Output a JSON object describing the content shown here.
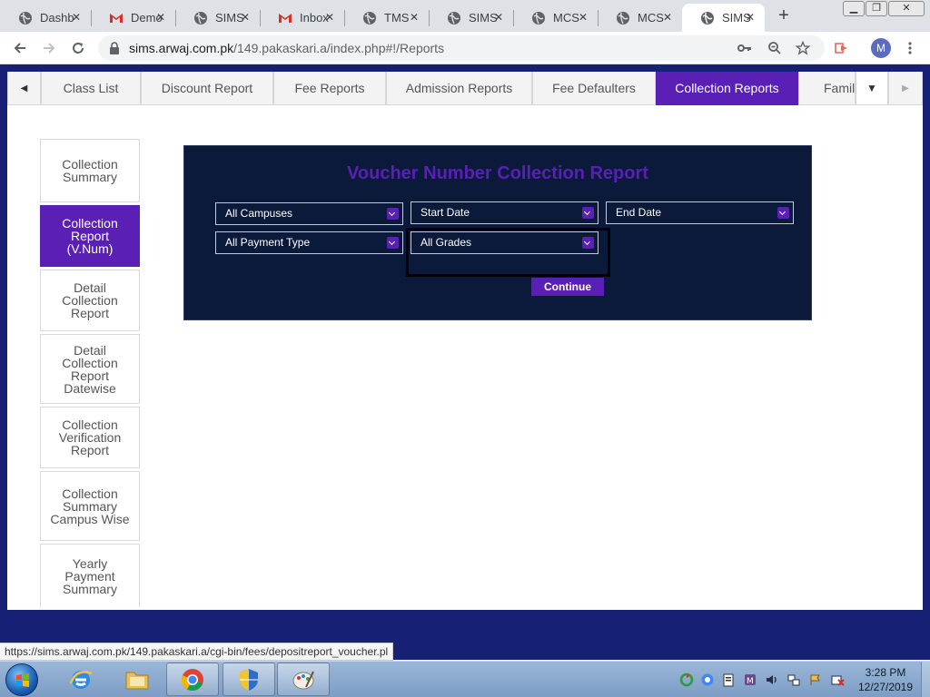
{
  "browser": {
    "tabs": [
      {
        "title": "Dashb",
        "icon": "globe-icon"
      },
      {
        "title": "Demo",
        "icon": "gmail-icon"
      },
      {
        "title": "SIMS",
        "icon": "globe-icon"
      },
      {
        "title": "Inbox",
        "icon": "gmail-icon"
      },
      {
        "title": "TMS",
        "icon": "globe-icon"
      },
      {
        "title": "SIMS",
        "icon": "globe-icon"
      },
      {
        "title": "MCS",
        "icon": "globe-icon"
      },
      {
        "title": "MCS",
        "icon": "globe-icon"
      },
      {
        "title": "SIMS",
        "icon": "globe-icon",
        "active": true
      }
    ],
    "url_host": "sims.arwaj.com.pk",
    "url_path": "/149.pakaskari.a/index.php#!/Reports",
    "profile_initial": "M"
  },
  "report_tabs": [
    {
      "label": "Class List"
    },
    {
      "label": "Discount Report"
    },
    {
      "label": "Fee Reports"
    },
    {
      "label": "Admission Reports"
    },
    {
      "label": "Fee Defaulters"
    },
    {
      "label": "Collection Reports",
      "active": true
    },
    {
      "label": "Family"
    }
  ],
  "sidebar": {
    "items": [
      {
        "label": "Collection Summary"
      },
      {
        "label": "Collection Report (V.Num)",
        "active": true
      },
      {
        "label": "Detail Collection Report"
      },
      {
        "label": "Detail Collection Report Datewise"
      },
      {
        "label": "Collection Verification Report"
      },
      {
        "label": "Collection Summary Campus Wise"
      },
      {
        "label": "Yearly Payment Summary"
      }
    ]
  },
  "panel": {
    "title": "Voucher Number Collection Report",
    "campus_select": "All Campuses",
    "start_date": "Start Date",
    "end_date": "End Date",
    "payment_type_select": "All Payment Type",
    "grades_select": "All Grades",
    "continue_label": "Continue",
    "accent_color": "#5a1fb5",
    "panel_color": "#0b1a3a"
  },
  "status_bar": {
    "url": "https://sims.arwaj.com.pk/149.pakaskari.a/cgi-bin/fees/depositreport_voucher.pl"
  },
  "taskbar": {
    "time": "3:28 PM",
    "date": "12/27/2019"
  }
}
